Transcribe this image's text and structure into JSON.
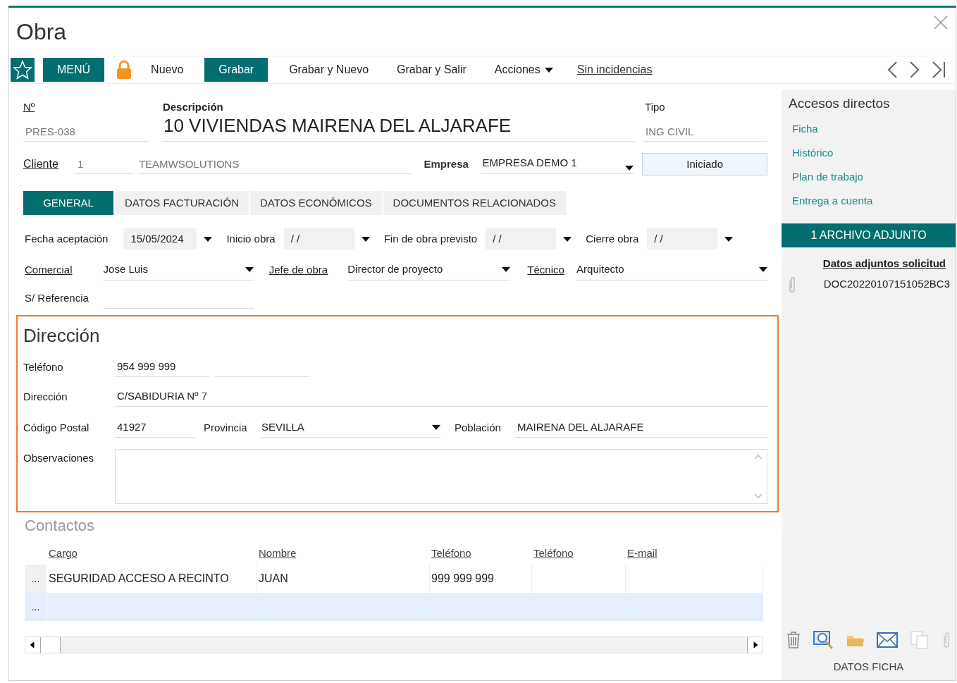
{
  "window": {
    "title": "Obra"
  },
  "toolbar": [
    {
      "kind": "star"
    },
    {
      "kind": "primary",
      "label": "MENÚ"
    },
    {
      "kind": "lock"
    },
    {
      "kind": "plain",
      "label": "Nuevo"
    },
    {
      "kind": "primary",
      "label": "Grabar"
    },
    {
      "kind": "plain",
      "label": "Grabar y Nuevo"
    },
    {
      "kind": "plain",
      "label": "Grabar y Salir"
    },
    {
      "kind": "dropdown",
      "label": "Acciones"
    },
    {
      "kind": "link",
      "label": "Sin incidencias"
    }
  ],
  "header": {
    "numero": {
      "label": "Nº",
      "value": "PRES-038"
    },
    "descripcion": {
      "label": "Descripción",
      "value": "10 VIVIENDAS MAIRENA DEL ALJARAFE"
    },
    "tipo": {
      "label": "Tipo",
      "value": "ING CIVIL"
    },
    "cliente": {
      "label": "Cliente",
      "code": "1",
      "name": "TEAMWSOLUTIONS"
    },
    "empresa": {
      "label": "Empresa",
      "value": "EMPRESA DEMO 1"
    },
    "status": "Iniciado"
  },
  "tabs": [
    {
      "label": "GENERAL",
      "selected": true
    },
    {
      "label": "DATOS FACTURACIÓN",
      "selected": false
    },
    {
      "label": "DATOS ECONÓMICOS",
      "selected": false
    },
    {
      "label": "DOCUMENTOS RELACIONADOS",
      "selected": false
    }
  ],
  "dates": [
    {
      "label": "Fecha aceptación",
      "value": "15/05/2024"
    },
    {
      "label": "Inicio obra",
      "value": "/ /"
    },
    {
      "label": "Fin de obra previsto",
      "value": "/ /"
    },
    {
      "label": "Cierre obra",
      "value": "/ /"
    }
  ],
  "people": [
    {
      "label": "Comercial",
      "value": "Jose Luis"
    },
    {
      "label": "Jefe de obra",
      "value": "Director de proyecto"
    },
    {
      "label": "Técnico",
      "value": "Arquitecto"
    }
  ],
  "referencia": {
    "label": "S/ Referencia"
  },
  "direccion": {
    "title": "Dirección",
    "telefono": {
      "label": "Teléfono",
      "value": "954 999 999"
    },
    "direccion": {
      "label": "Dirección",
      "value": "C/SABIDURIA Nº 7"
    },
    "codigo_postal": {
      "label": "Código Postal",
      "value": "41927"
    },
    "provincia": {
      "label": "Provincia",
      "value": "SEVILLA"
    },
    "poblacion": {
      "label": "Población",
      "value": "MAIRENA DEL ALJARAFE"
    },
    "observaciones": {
      "label": "Observaciones"
    }
  },
  "contactos": {
    "title": "Contactos",
    "columns": [
      "Cargo",
      "Nombre",
      "Teléfono",
      "Teléfono",
      "E-mail"
    ],
    "rows": [
      {
        "marker": "...",
        "cells": [
          "SEGURIDAD ACCESO A RECINTO",
          "JUAN",
          "999 999 999"
        ],
        "selected": false
      },
      {
        "marker": "...",
        "selected": true
      }
    ]
  },
  "accesos": {
    "title": "Accesos directos",
    "links": [
      "Ficha",
      "Histórico",
      "Plan de trabajo",
      "Entrega a cuenta"
    ]
  },
  "adjuntos": {
    "header": "1 ARCHIVO ADJUNTO",
    "title": "Datos adjuntos solicitud",
    "files": [
      "DOC20220107151052BC3"
    ]
  },
  "footer": "DATOS FICHA"
}
